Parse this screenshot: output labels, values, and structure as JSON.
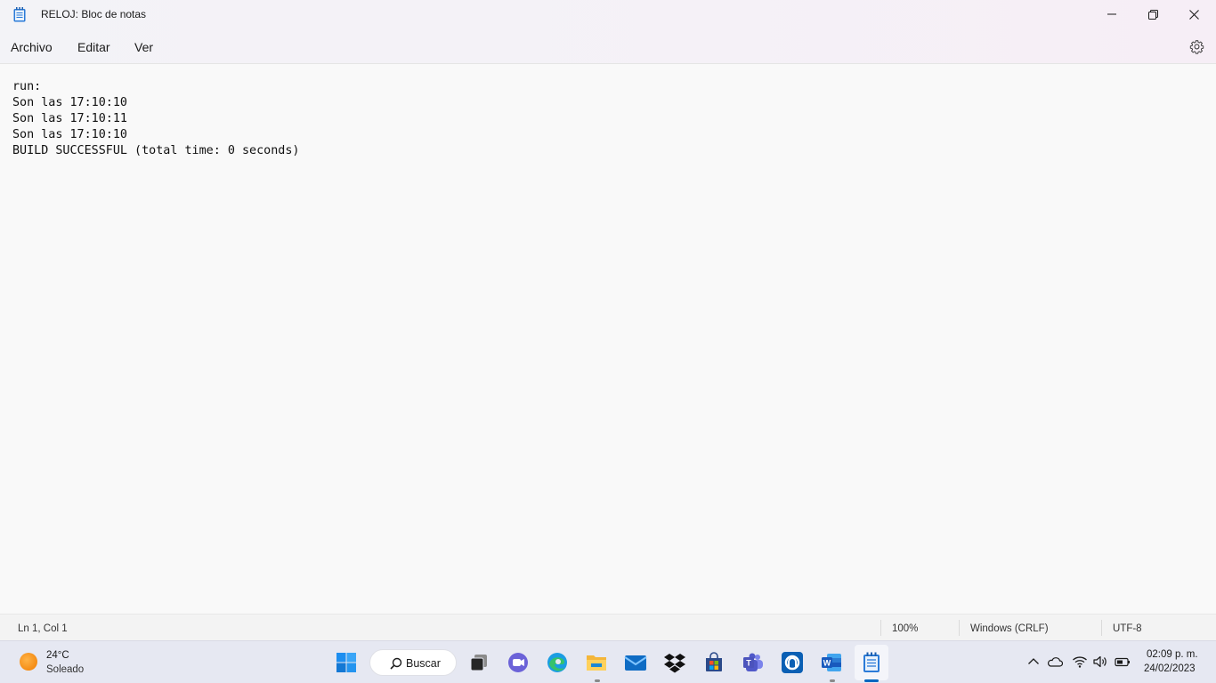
{
  "window": {
    "title": "RELOJ: Bloc de notas",
    "app_icon": "notepad-icon"
  },
  "menu": {
    "items": [
      "Archivo",
      "Editar",
      "Ver"
    ],
    "settings_icon": "gear-icon"
  },
  "editor": {
    "lines": [
      "run:",
      "Son las 17:10:10",
      "Son las 17:10:11",
      "Son las 17:10:10",
      "BUILD SUCCESSFUL (total time: 0 seconds)"
    ]
  },
  "status": {
    "position": "Ln 1, Col 1",
    "zoom": "100%",
    "line_ending": "Windows (CRLF)",
    "encoding": "UTF-8"
  },
  "taskbar": {
    "weather": {
      "temp": "24°C",
      "condition": "Soleado",
      "icon": "sun-icon"
    },
    "search_label": "Buscar",
    "apps": [
      "start-icon",
      "search-icon",
      "task-view-icon",
      "chat-icon",
      "edge-icon",
      "file-explorer-icon",
      "mail-icon",
      "dropbox-icon",
      "store-icon",
      "teams-icon",
      "app-icon",
      "word-icon",
      "notepad-icon"
    ],
    "tray": [
      "chevron-up-icon",
      "onedrive-icon",
      "wifi-icon",
      "volume-icon",
      "battery-icon"
    ],
    "clock_time": "02:09 p. m.",
    "clock_date": "24/02/2023"
  },
  "colors": {
    "accent": "#0067c0",
    "taskbar_bg": "#e6e8f2",
    "editor_bg": "#f9f9f9"
  }
}
